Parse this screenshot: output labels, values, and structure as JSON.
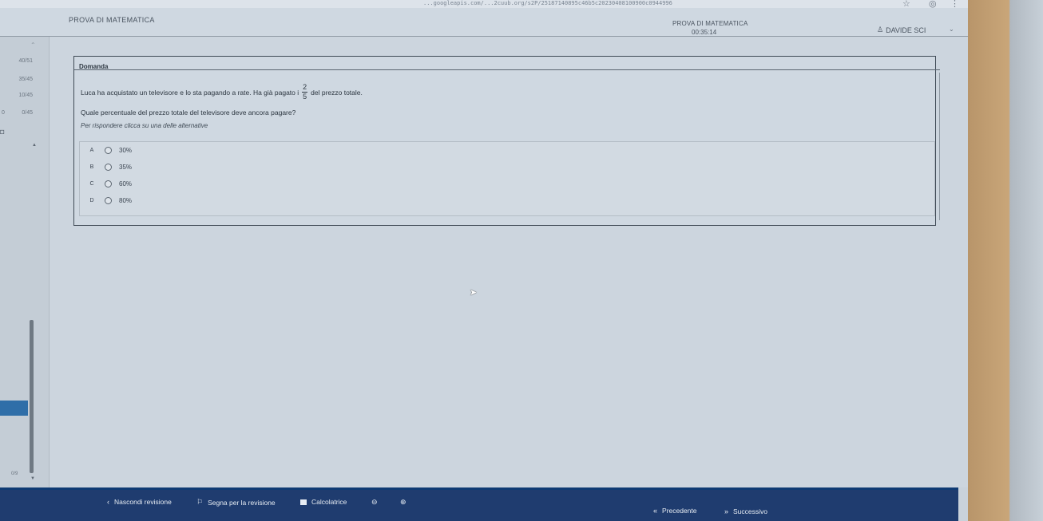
{
  "browser": {
    "url_fragment": "...googleapis.com/...2cuub.org/s2P/25187140895c46b5c20230408100900c0944996",
    "star_icon": "star-icon",
    "account_icon": "account-icon",
    "menu_icon": "menu-dots-icon"
  },
  "header": {
    "app_title": "PROVA DI MATEMATICA",
    "exam_title": "PROVA DI MATEMATICA",
    "timer": "00:35:14",
    "user_name": "DAVIDE SCI",
    "user_icon": "user-icon",
    "chevron_icon": "chevron-down-icon"
  },
  "sidebar": {
    "scores": [
      "40/51",
      "35/45",
      "10/45",
      "0/45"
    ],
    "zero_label": "0",
    "footer_score": "0/9",
    "active_color": "#2f6ea8"
  },
  "question": {
    "section_label": "Domanda",
    "line1_before": "Luca ha acquistato un televisore e lo sta pagando a rate. Ha già pagato i",
    "fraction_numerator": "2",
    "fraction_denominator": "5",
    "line1_after": "del prezzo totale.",
    "line2": "Quale percentuale del prezzo totale del televisore deve ancora pagare?",
    "instructions": "Per rispondere clicca su una delle alternative",
    "options": [
      {
        "letter": "A",
        "text": "30%"
      },
      {
        "letter": "B",
        "text": "35%"
      },
      {
        "letter": "C",
        "text": "60%"
      },
      {
        "letter": "D",
        "text": "80%"
      }
    ]
  },
  "footer": {
    "hide_review": "Nascondi revisione",
    "mark_review": "Segna per la revisione",
    "calculator": "Calcolatrice",
    "previous": "Precedente",
    "next": "Successivo",
    "bar_color": "#1f3c6f"
  }
}
